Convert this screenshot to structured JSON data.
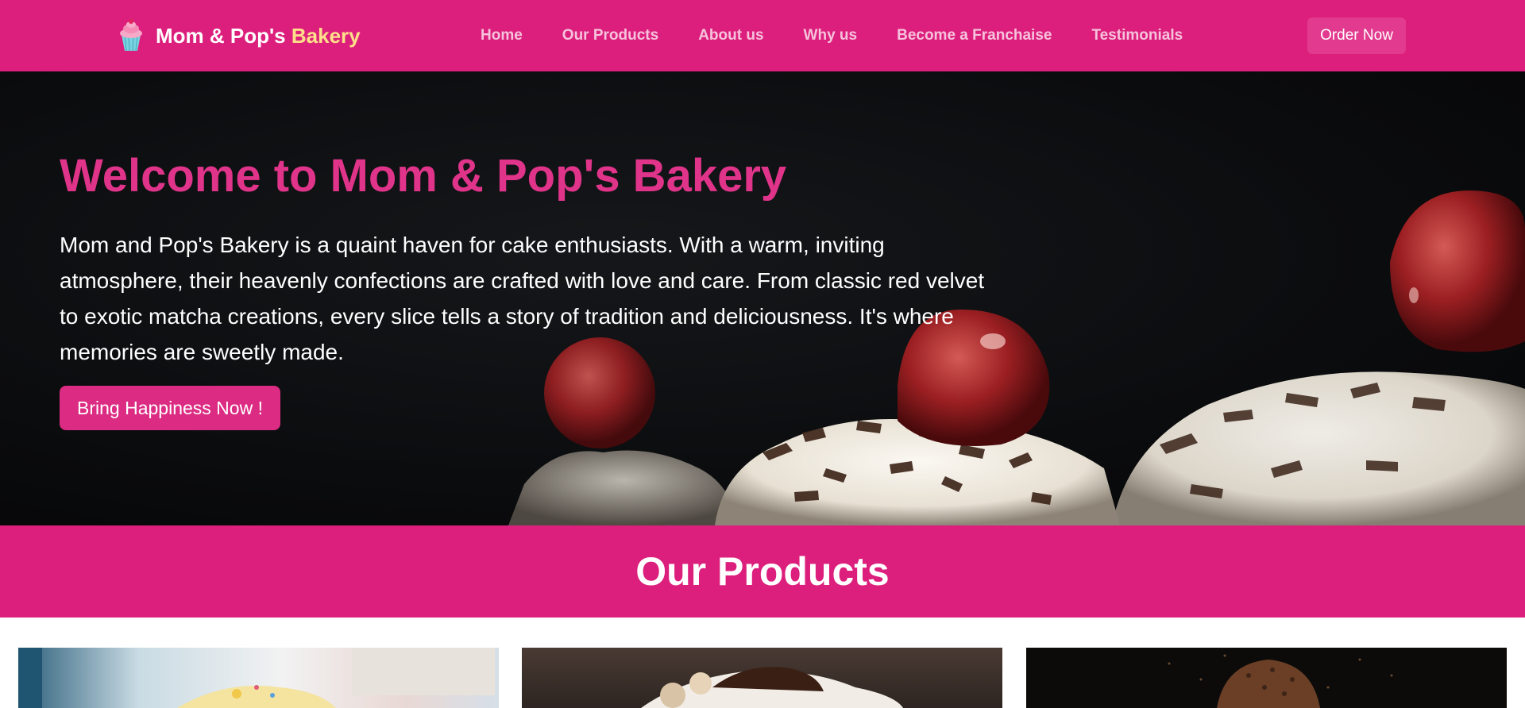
{
  "navbar": {
    "brand": {
      "name": "Mom & Pop's",
      "accent": "Bakery",
      "logo_icon": "cupcake-icon"
    },
    "links": [
      "Home",
      "Our Products",
      "About us",
      "Why us",
      "Become a Franchaise",
      "Testimonials"
    ],
    "order_label": "Order Now"
  },
  "hero": {
    "title": "Welcome to Mom & Pop's Bakery",
    "description": "Mom and Pop's Bakery is a quaint haven for cake enthusiasts. With a warm, inviting atmosphere, their heavenly confections are crafted with love and care. From classic red velvet to exotic matcha creations, every slice tells a story of tradition and deliciousness. It's where memories are sweetly made.",
    "cta_label": "Bring Happiness Now !",
    "background_image": "black-forest-cake-slices-with-cherries"
  },
  "products": {
    "heading": "Our Products",
    "cards": [
      {
        "image": "decorated-birthday-cake"
      },
      {
        "image": "chocolate-cream-dessert"
      },
      {
        "image": "chocolate-cupcake"
      }
    ]
  },
  "colors": {
    "brand_pink": "#dc1f7c",
    "title_pink": "#e0348a",
    "accent_yellow": "#ffe08a",
    "nav_link": "#f6c2dc"
  }
}
